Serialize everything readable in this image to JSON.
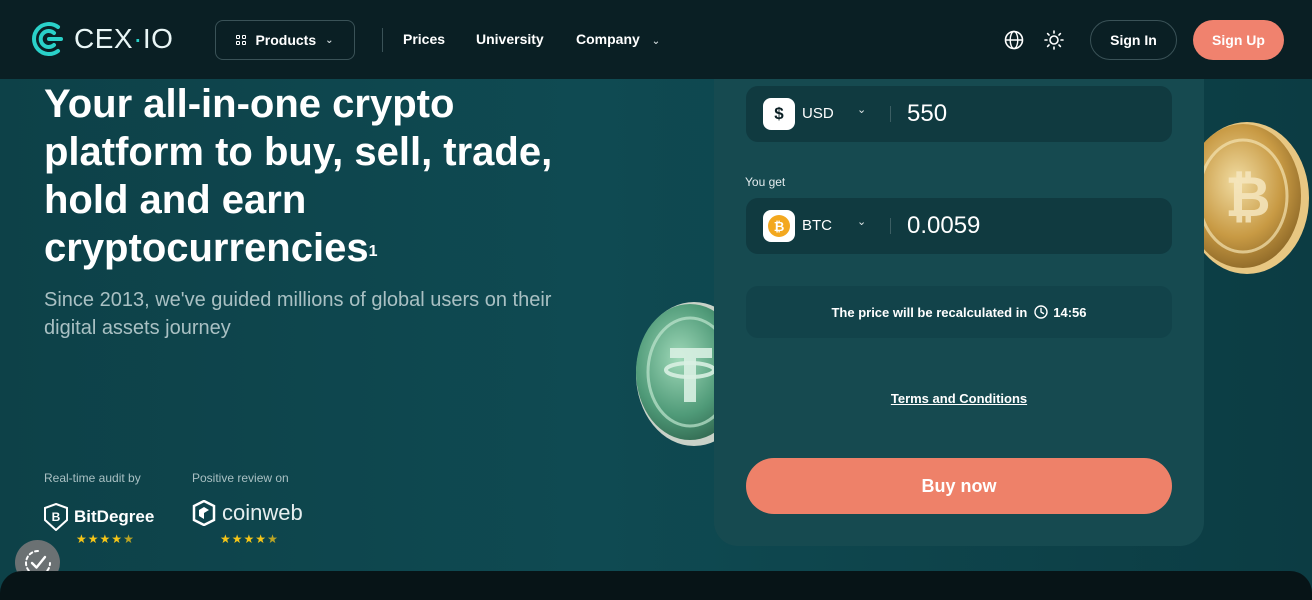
{
  "header": {
    "logo_text": "CEX",
    "logo_dot": "·",
    "logo_suffix": "IO",
    "products_label": "Products",
    "nav": [
      "Prices",
      "University",
      "Company"
    ],
    "sign_in": "Sign In",
    "sign_up": "Sign Up"
  },
  "hero": {
    "title": "Your all-in-one crypto platform to buy, sell, trade, hold and earn cryptocurrencies",
    "title_footnote": "1",
    "subtitle": "Since 2013, we've guided millions of global users on their digital assets journey"
  },
  "trust": [
    {
      "label": "Real-time audit by",
      "brand": "BitDegree",
      "rating": 4.5
    },
    {
      "label": "Positive review on",
      "brand": "coinweb",
      "rating": 4.5
    }
  ],
  "widget": {
    "pay_currency": "USD",
    "pay_symbol": "$",
    "pay_amount": "550",
    "get_label": "You get",
    "get_currency": "BTC",
    "get_symbol": "₿",
    "get_amount": "0.0059",
    "recalc_text": "The price will be recalculated in",
    "timer": "14:56",
    "terms": "Terms and Conditions",
    "buy": "Buy now"
  },
  "colors": {
    "accent": "#f0826e",
    "brand_teal": "#2ad1c9",
    "header_bg": "#0a1f24",
    "star": "#f5c518"
  },
  "icons": [
    "cex-logo-icon",
    "grid-icon",
    "globe-icon",
    "sun-icon",
    "clock-icon",
    "cookie-settings-icon",
    "bitdegree-icon",
    "coinweb-icon",
    "tether-coin",
    "bitcoin-coin"
  ]
}
